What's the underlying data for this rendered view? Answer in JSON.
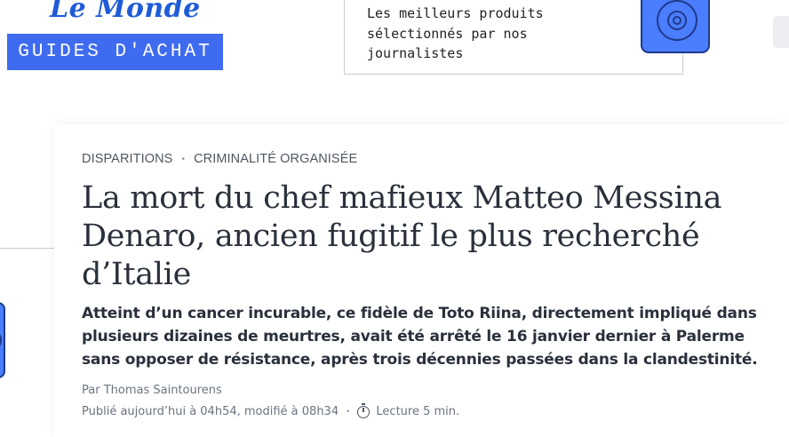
{
  "header": {
    "logo_text": "Le Monde",
    "section_label": "GUIDES D'ACHAT",
    "promo_text": "Les meilleurs produits\nsélectionnés par nos\njournalistes",
    "promo_icon": "camera-icon",
    "accent_color": "#3f6bf0"
  },
  "article": {
    "tags": [
      "DISPARITIONS",
      "CRIMINALITÉ ORGANISÉE"
    ],
    "headline": "La mort du chef mafieux Matteo Messina Denaro, ancien fugitif le plus recherché d’Italie",
    "standfirst": "Atteint d’un cancer incurable, ce fidèle de Toto Riina, directement impliqué dans plusieurs dizaines de meurtres, avait été arrêté le 16 janvier dernier à Palerme sans opposer de résistance, après trois décennies passées dans la clandestinité.",
    "byline": "Par Thomas Saintourens",
    "published": "Publié aujourd’hui à 04h54, modifié à 08h34",
    "reading_icon": "clock-icon",
    "reading_time": "Lecture 5 min."
  }
}
